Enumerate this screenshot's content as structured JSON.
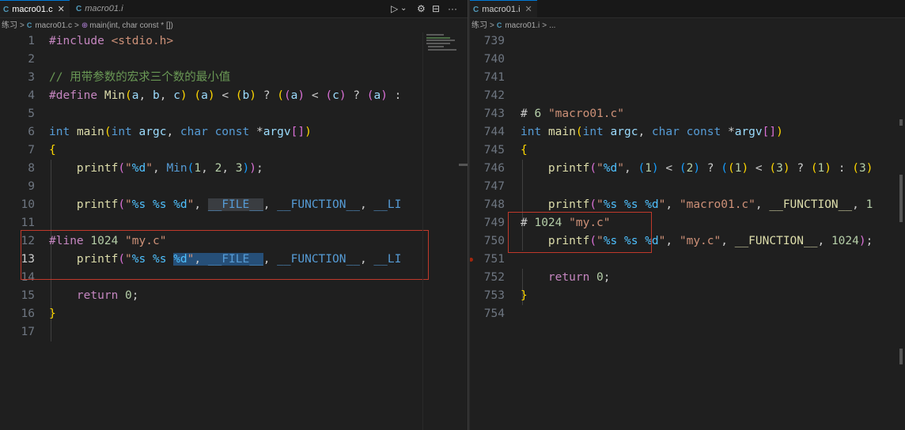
{
  "left_editor": {
    "tabs": [
      {
        "icon": "C",
        "label": "macro01.c",
        "close": "✕",
        "active": true
      },
      {
        "icon": "C",
        "label": "macro01.i",
        "active": false
      }
    ],
    "toolbar": {
      "run_icon": "▷",
      "run_chevron": "⌄",
      "gear_icon": "⚙",
      "split_icon": "⊟",
      "more_icon": "···"
    },
    "breadcrumb": {
      "folder": "练习",
      "sep": ">",
      "file_icon": "C",
      "file": "macro01.c",
      "symbol_icon": "⊕",
      "symbol": "main(int, char const * [])"
    },
    "line_numbers": [
      "1",
      "2",
      "3",
      "4",
      "5",
      "6",
      "7",
      "8",
      "9",
      "10",
      "11",
      "12",
      "13",
      "14",
      "15",
      "16",
      "17"
    ],
    "lines": [
      {
        "n": "1",
        "t": "#include <stdio.h>"
      },
      {
        "n": "2",
        "t": ""
      },
      {
        "n": "3",
        "t": "// 用带参数的宏求三个数的最小值"
      },
      {
        "n": "4",
        "t": "#define Min(a, b, c) (a) < (b) ? ((a) < (c) ? (a) :"
      },
      {
        "n": "5",
        "t": ""
      },
      {
        "n": "6",
        "t": "int main(int argc, char const *argv[])"
      },
      {
        "n": "7",
        "t": "{"
      },
      {
        "n": "8",
        "t": "    printf(\"%d\", Min(1, 2, 3));"
      },
      {
        "n": "9",
        "t": ""
      },
      {
        "n": "10",
        "t": "    printf(\"%s %s %d\", __FILE__, __FUNCTION__, __LI"
      },
      {
        "n": "11",
        "t": ""
      },
      {
        "n": "12",
        "t": "#line 1024 \"my.c\""
      },
      {
        "n": "13",
        "t": "    printf(\"%s %s %d\", __FILE__, __FUNCTION__, __LI"
      },
      {
        "n": "14",
        "t": ""
      },
      {
        "n": "15",
        "t": "    return 0;"
      },
      {
        "n": "16",
        "t": "}"
      },
      {
        "n": "17",
        "t": ""
      }
    ]
  },
  "right_editor": {
    "tabs": [
      {
        "icon": "C",
        "label": "macro01.i",
        "close": "✕",
        "active": true
      }
    ],
    "breadcrumb": {
      "folder": "练习",
      "sep": ">",
      "file_icon": "C",
      "file": "macro01.i",
      "rest": "..."
    },
    "lines": [
      {
        "n": "739",
        "t": ""
      },
      {
        "n": "740",
        "t": ""
      },
      {
        "n": "741",
        "t": ""
      },
      {
        "n": "742",
        "t": ""
      },
      {
        "n": "743",
        "t": "# 6 \"macro01.c\""
      },
      {
        "n": "744",
        "t": "int main(int argc, char const *argv[])"
      },
      {
        "n": "745",
        "t": "{"
      },
      {
        "n": "746",
        "t": "    printf(\"%d\", (1) < (2) ? ((1) < (3) ? (1) : (3)"
      },
      {
        "n": "747",
        "t": ""
      },
      {
        "n": "748",
        "t": "    printf(\"%s %s %d\", \"macro01.c\", __FUNCTION__, 1"
      },
      {
        "n": "749",
        "t": "# 1024 \"my.c\""
      },
      {
        "n": "750",
        "t": "    printf(\"%s %s %d\", \"my.c\", __FUNCTION__, 1024);"
      },
      {
        "n": "751",
        "t": ""
      },
      {
        "n": "752",
        "t": "    return 0;"
      },
      {
        "n": "753",
        "t": "}"
      },
      {
        "n": "754",
        "t": ""
      }
    ]
  },
  "colors": {
    "background": "#1f1f1f",
    "keyword": "#c586c0",
    "type": "#569cd6",
    "function": "#dcdcaa",
    "string": "#ce9178",
    "number": "#b5cea8",
    "comment": "#6a9955",
    "highlight_box": "#c0392b"
  }
}
